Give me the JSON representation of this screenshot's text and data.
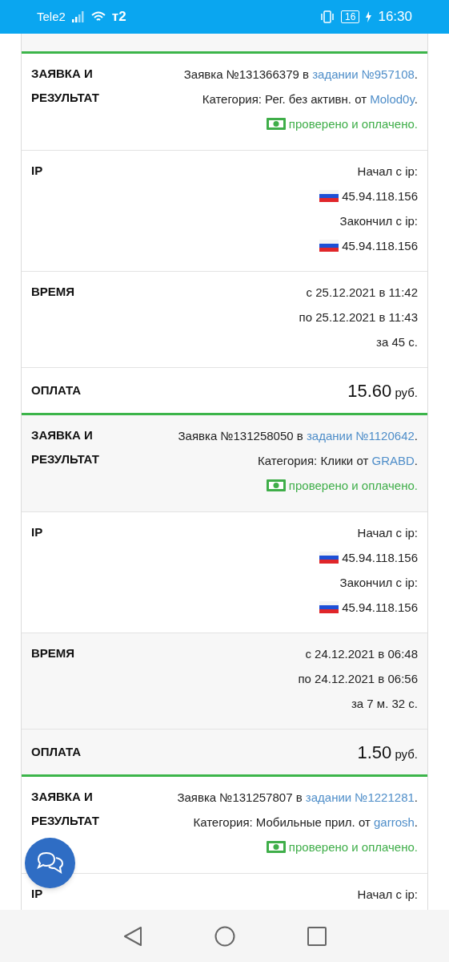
{
  "status_bar": {
    "carrier": "Tele2",
    "operator_logo": "т2",
    "battery": "16",
    "time": "16:30"
  },
  "records": [
    {
      "request": {
        "label": "ЗАЯВКА И РЕЗУЛЬТАТ",
        "order": {
          "before": "Заявка №131366379 в",
          "link": "задании №957108",
          "after": "."
        },
        "category": {
          "before": "Категория: Рег. без активн. от",
          "link": "Molod0y",
          "after": "."
        },
        "status": "проверено и оплачено."
      },
      "ip": {
        "label": "IP",
        "start_label": "Начал с ip:",
        "start_ip": "45.94.118.156",
        "end_label": "Закончил с ip:",
        "end_ip": "45.94.118.156"
      },
      "time": {
        "label": "ВРЕМЯ",
        "from": "с 25.12.2021 в 11:42",
        "to": "по 25.12.2021 в 11:43",
        "duration": "за 45 с."
      },
      "payment": {
        "label": "ОПЛАТА",
        "amount": "15.60",
        "currency": "руб."
      }
    },
    {
      "request": {
        "label": "ЗАЯВКА И РЕЗУЛЬТАТ",
        "order": {
          "before": "Заявка №131258050 в",
          "link": "задании №1120642",
          "after": "."
        },
        "category": {
          "before": "Категория: Клики от",
          "link": "GRABD",
          "after": "."
        },
        "status": "проверено и оплачено."
      },
      "ip": {
        "label": "IP",
        "start_label": "Начал с ip:",
        "start_ip": "45.94.118.156",
        "end_label": "Закончил с ip:",
        "end_ip": "45.94.118.156"
      },
      "time": {
        "label": "ВРЕМЯ",
        "from": "с 24.12.2021 в 06:48",
        "to": "по 24.12.2021 в 06:56",
        "duration": "за 7 м. 32 с."
      },
      "payment": {
        "label": "ОПЛАТА",
        "amount": "1.50",
        "currency": "руб."
      }
    },
    {
      "request": {
        "label": "ЗАЯВКА И РЕЗУЛЬТАТ",
        "order": {
          "before": "Заявка №131257807 в",
          "link": "задании №1221281",
          "after": "."
        },
        "category": {
          "before": "Категория: Мобильные прил. от",
          "link": "garrosh",
          "after": "."
        },
        "status": "проверено и оплачено."
      },
      "ip": {
        "label": "IP",
        "start_label": "Начал с ip:"
      }
    }
  ]
}
